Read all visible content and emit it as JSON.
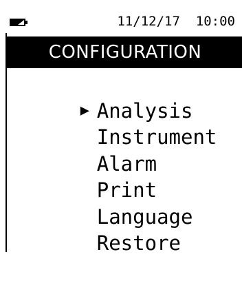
{
  "status_bar": {
    "battery_icon": "battery-icon",
    "date": "11/12/17",
    "time": "10:00"
  },
  "header": {
    "title": "CONFIGURATION"
  },
  "menu": {
    "cursor_glyph": "▶",
    "selected_index": 0,
    "items": [
      {
        "label": "Analysis"
      },
      {
        "label": "Instrument"
      },
      {
        "label": "Alarm"
      },
      {
        "label": "Print"
      },
      {
        "label": "Language"
      },
      {
        "label": "Restore"
      }
    ]
  }
}
